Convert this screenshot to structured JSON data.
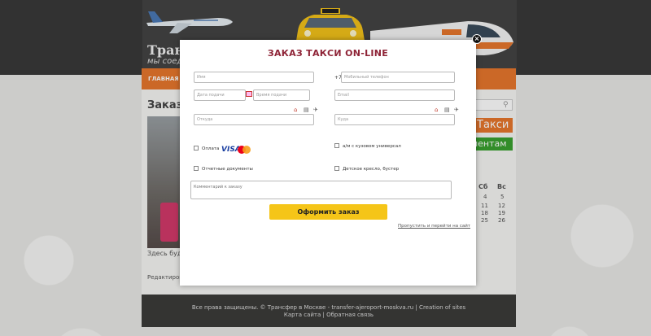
{
  "site": {
    "logo_text": "Трансфер",
    "logo_sub": "мы соед",
    "nav_home": "ГЛАВНАЯ",
    "page_heading": "Заказ т",
    "photo_caption": "Здесь будет",
    "edit_link": "Редактировать",
    "sidebar_taxi_button": "Такси",
    "sidebar_clients_button": "иентам",
    "calendar": {
      "headers": [
        "Сб",
        "Вс"
      ],
      "rows": [
        [
          "4",
          "5"
        ],
        [
          "11",
          "12"
        ],
        [
          "18",
          "19"
        ],
        [
          "25",
          "26"
        ]
      ]
    },
    "footer_line1": "Все права защищены. © Трансфер в Москве - transfer-ajeroport-moskva.ru | Creation of sites",
    "footer_line2": "Карта сайта | Обратная связь",
    "colors": {
      "nav": "#e8772d",
      "taxi_button": "#e8772d",
      "clients_button": "#3aa12f",
      "footer": "#3c3c3a"
    }
  },
  "modal": {
    "title": "ЗАКАЗ ТАКСИ ON-LINE",
    "close_icon": "close-icon",
    "fields": {
      "name_placeholder": "Имя",
      "phone_prefix": "+7",
      "phone_placeholder": "Мобильный телефон",
      "date_placeholder": "Дата подачи",
      "time_placeholder": "Время подачи",
      "email_placeholder": "Email",
      "from_placeholder": "Откуда",
      "to_placeholder": "Куда",
      "comment_placeholder": "Комментарий к заказу"
    },
    "options": {
      "payment_label": "Оплата",
      "visa_text": "VISA",
      "wagon_label": "а/м с кузовом универсал",
      "reports_label": "Отчетные документы",
      "child_seat_label": "Детское кресло, бустер"
    },
    "submit_label": "Оформить заказ",
    "skip_link": "Пропустить и перейти на сайт",
    "colors": {
      "title": "#8e2336",
      "submit": "#f5c518"
    }
  }
}
